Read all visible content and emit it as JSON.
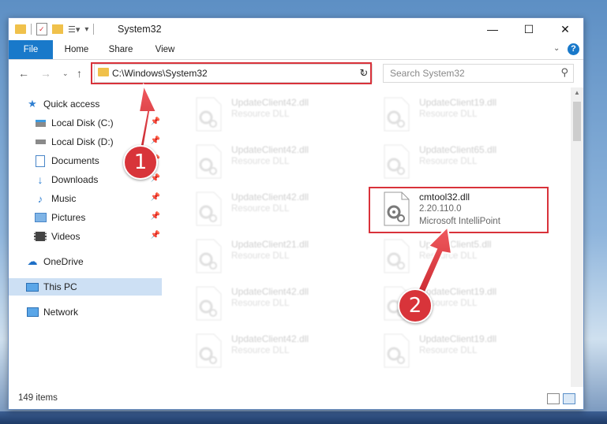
{
  "window": {
    "title": "System32",
    "minimize": "—",
    "maximize": "☐",
    "close": "✕"
  },
  "ribbon": {
    "file": "File",
    "tabs": [
      "Home",
      "Share",
      "View"
    ],
    "help": "?"
  },
  "address": {
    "path": "C:\\Windows\\System32",
    "search_placeholder": "Search System32"
  },
  "sidebar": {
    "quick_access": "Quick access",
    "items": [
      {
        "label": "Local Disk (C:)",
        "icon": "drive-icon"
      },
      {
        "label": "Local Disk (D:)",
        "icon": "drive-icon"
      },
      {
        "label": "Documents",
        "icon": "documents-icon"
      },
      {
        "label": "Downloads",
        "icon": "downloads-icon"
      },
      {
        "label": "Music",
        "icon": "music-icon"
      },
      {
        "label": "Pictures",
        "icon": "pictures-icon"
      },
      {
        "label": "Videos",
        "icon": "videos-icon"
      }
    ],
    "onedrive": "OneDrive",
    "this_pc": "This PC",
    "network": "Network"
  },
  "files": {
    "left": [
      {
        "name": "UpdateClient42.dll",
        "desc": "Resource DLL"
      },
      {
        "name": "UpdateClient42.dll",
        "desc": "Resource DLL"
      },
      {
        "name": "UpdateClient42.dll",
        "desc": "Resource DLL"
      },
      {
        "name": "UpdateClient21.dll",
        "desc": "Resource DLL"
      },
      {
        "name": "UpdateClient42.dll",
        "desc": "Resource DLL"
      },
      {
        "name": "UpdateClient42.dll",
        "desc": "Resource DLL"
      }
    ],
    "right": [
      {
        "name": "UpdateClient19.dll",
        "desc": "Resource DLL"
      },
      {
        "name": "UpdateClient65.dll",
        "desc": "Resource DLL"
      },
      {
        "name": "UpdateClient5.dll",
        "desc": "Resource DLL"
      },
      {
        "name": "UpdateClient19.dll",
        "desc": "Resource DLL"
      },
      {
        "name": "UpdateClient19.dll",
        "desc": "Resource DLL"
      }
    ],
    "highlight": {
      "name": "cmtool32.dll",
      "version": "2.20.110.0",
      "company": "Microsoft IntelliPoint"
    }
  },
  "status": {
    "count": "149 items"
  },
  "callouts": [
    "1",
    "2"
  ],
  "colors": {
    "accent": "#1979ca",
    "highlight": "#d9323a"
  }
}
